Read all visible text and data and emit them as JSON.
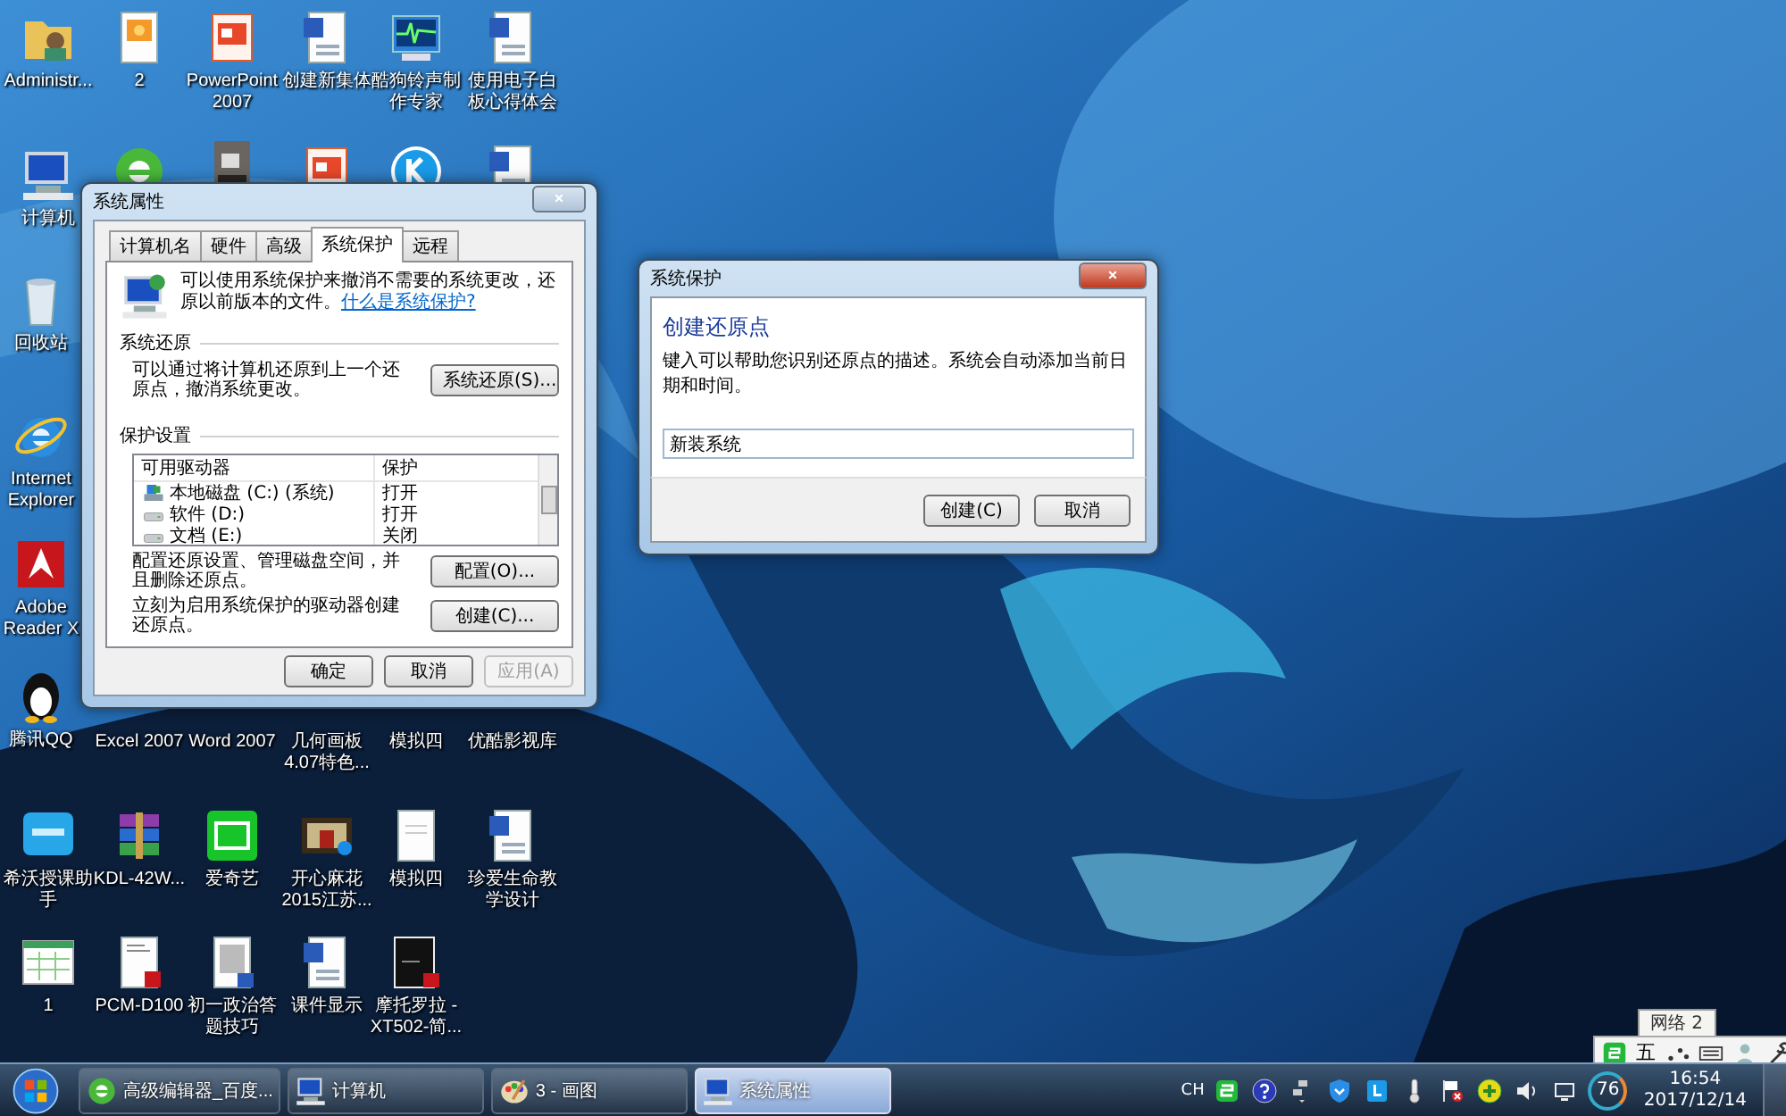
{
  "desktop_icons": [
    {
      "label": "Administr..."
    },
    {
      "label": "2"
    },
    {
      "label": "PowerPoint 2007"
    },
    {
      "label": "创建新集体"
    },
    {
      "label": "酷狗铃声制作专家"
    },
    {
      "label": "使用电子白板心得体会"
    },
    {
      "label": "计算机"
    },
    {
      "label": "回收站"
    },
    {
      "label": "Internet Explorer"
    },
    {
      "label": "Adobe Reader X"
    },
    {
      "label": "腾讯QQ"
    },
    {
      "label": "Excel 2007"
    },
    {
      "label": "Word 2007"
    },
    {
      "label": "几何画板 4.07特色..."
    },
    {
      "label": "模拟四"
    },
    {
      "label": "优酷影视库"
    },
    {
      "label": "希沃授课助手"
    },
    {
      "label": "KDL-42W..."
    },
    {
      "label": "爱奇艺"
    },
    {
      "label": "开心麻花 2015江苏..."
    },
    {
      "label": "模拟四"
    },
    {
      "label": "珍爱生命教学设计"
    },
    {
      "label": "1"
    },
    {
      "label": "PCM-D100"
    },
    {
      "label": "初一政治答题技巧"
    },
    {
      "label": "课件显示"
    },
    {
      "label": "摩托罗拉 -XT502-简..."
    }
  ],
  "system_properties": {
    "title": "系统属性",
    "tabs": [
      {
        "label": "计算机名",
        "selected": false
      },
      {
        "label": "硬件",
        "selected": false
      },
      {
        "label": "高级",
        "selected": false
      },
      {
        "label": "系统保护",
        "selected": true
      },
      {
        "label": "远程",
        "selected": false
      }
    ],
    "intro": "可以使用系统保护来撤消不需要的系统更改，还原以前版本的文件。",
    "intro_link": "什么是系统保护?",
    "restore_heading": "系统还原",
    "restore_text": "可以通过将计算机还原到上一个还原点，撤消系统更改。",
    "restore_button": "系统还原(S)...",
    "settings_heading": "保护设置",
    "drive_columns": [
      "可用驱动器",
      "保护"
    ],
    "drives": [
      {
        "name": "本地磁盘 (C:) (系统)",
        "protection": "打开"
      },
      {
        "name": "软件 (D:)",
        "protection": "打开"
      },
      {
        "name": "文档 (E:)",
        "protection": "关闭"
      }
    ],
    "configure_text": "配置还原设置、管理磁盘空间，并且删除还原点。",
    "configure_button": "配置(O)...",
    "create_text": "立刻为启用系统保护的驱动器创建还原点。",
    "create_button": "创建(C)...",
    "footer_buttons": [
      {
        "label": "确定",
        "disabled": false
      },
      {
        "label": "取消",
        "disabled": false
      },
      {
        "label": "应用(A)",
        "disabled": true
      }
    ]
  },
  "restore_point_dialog": {
    "title": "系统保护",
    "heading": "创建还原点",
    "text": "键入可以帮助您识别还原点的描述。系统会自动添加当前日期和时间。",
    "value": "新装系统",
    "buttons": [
      "创建(C)",
      "取消"
    ]
  },
  "ime_bar": {
    "tooltip": "网络 2",
    "mode": "五"
  },
  "taskbar": {
    "tasks": [
      {
        "label": "高级编辑器_百度...",
        "selected": false
      },
      {
        "label": "计算机",
        "selected": false
      },
      {
        "label": "3 - 画图",
        "selected": false
      },
      {
        "label": "系统属性",
        "selected": true
      }
    ],
    "language": "CH",
    "gauge": "76",
    "time": "16:54",
    "date": "2017/12/14"
  }
}
